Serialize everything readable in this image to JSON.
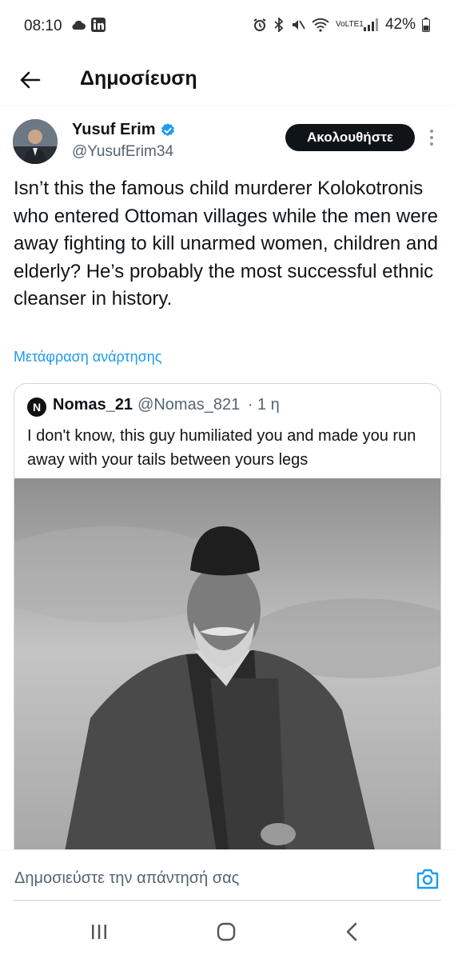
{
  "status_bar": {
    "time": "08:10",
    "battery": "42%",
    "network_label": "VoLTE1"
  },
  "header": {
    "title": "Δημοσίευση"
  },
  "post": {
    "author_name": "Yusuf Erim",
    "author_handle": "@YusufErim34",
    "follow_label": "Ακολουθήστε",
    "text": "Isn’t this the famous child murderer Kolokotronis who entered Ottoman villages while the men were away fighting to kill unarmed women, children and elderly? He’s probably the most successful ethnic cleanser in history.",
    "translate_label": "Μετάφραση ανάρτησης",
    "verified_color": "#1d9bf0"
  },
  "quote": {
    "avatar_letter": "N",
    "name": "Nomas_21",
    "handle": "@Nomas_821",
    "time": "· 1 η",
    "text": "I don't know, this guy humiliated you and made you run away with your tails between yours legs"
  },
  "reply": {
    "placeholder": "Δημοσιεύστε την απάντησή σας"
  }
}
